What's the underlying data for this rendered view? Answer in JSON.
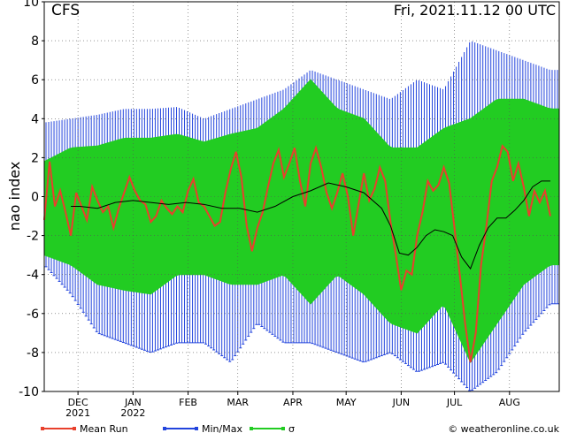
{
  "model_label": "CFS",
  "run_label": "Fri, 2021.11.12   00 UTC",
  "credit": "© weatheronline.co.uk",
  "legend": [
    {
      "label": "Mean Run",
      "color": "#e8402c"
    },
    {
      "label": "Min/Max",
      "color": "#2244dd"
    },
    {
      "label": "σ",
      "color": "#22cc22"
    }
  ],
  "chart_data": {
    "type": "line",
    "title": "",
    "ylabel": "nao index",
    "ylim": [
      -10,
      10
    ],
    "yticks": [
      -10,
      -8,
      -6,
      -4,
      -2,
      0,
      2,
      4,
      6,
      8,
      10
    ],
    "xlim": [
      0,
      290
    ],
    "month_ticks": [
      {
        "label": "DEC",
        "sub": "2021",
        "x": 19
      },
      {
        "label": "JAN",
        "sub": "2022",
        "x": 50
      },
      {
        "label": "FEB",
        "sub": "",
        "x": 81
      },
      {
        "label": "MAR",
        "sub": "",
        "x": 109
      },
      {
        "label": "APR",
        "sub": "",
        "x": 140
      },
      {
        "label": "MAY",
        "sub": "",
        "x": 170
      },
      {
        "label": "JUN",
        "sub": "",
        "x": 201
      },
      {
        "label": "JUL",
        "sub": "",
        "x": 231
      },
      {
        "label": "AUG",
        "sub": "",
        "x": 262
      }
    ],
    "series": [
      {
        "name": "Mean Run",
        "color": "#e8402c",
        "points": [
          [
            0,
            -1.2
          ],
          [
            3,
            1.8
          ],
          [
            6,
            -0.5
          ],
          [
            9,
            0.3
          ],
          [
            12,
            -0.8
          ],
          [
            15,
            -2.0
          ],
          [
            18,
            0.2
          ],
          [
            21,
            -0.5
          ],
          [
            24,
            -1.2
          ],
          [
            27,
            0.5
          ],
          [
            30,
            -0.2
          ],
          [
            33,
            -0.8
          ],
          [
            36,
            -0.5
          ],
          [
            39,
            -1.6
          ],
          [
            42,
            -0.6
          ],
          [
            45,
            0.2
          ],
          [
            48,
            1.0
          ],
          [
            51,
            0.3
          ],
          [
            54,
            -0.2
          ],
          [
            57,
            -0.4
          ],
          [
            60,
            -1.3
          ],
          [
            63,
            -1.0
          ],
          [
            66,
            -0.2
          ],
          [
            69,
            -0.6
          ],
          [
            72,
            -0.9
          ],
          [
            75,
            -0.5
          ],
          [
            78,
            -0.8
          ],
          [
            81,
            0.3
          ],
          [
            84,
            0.9
          ],
          [
            87,
            -0.3
          ],
          [
            90,
            -0.5
          ],
          [
            93,
            -1.0
          ],
          [
            96,
            -1.5
          ],
          [
            99,
            -1.3
          ],
          [
            102,
            0.2
          ],
          [
            105,
            1.4
          ],
          [
            108,
            2.3
          ],
          [
            111,
            1.0
          ],
          [
            114,
            -1.5
          ],
          [
            117,
            -2.8
          ],
          [
            120,
            -1.6
          ],
          [
            123,
            -0.8
          ],
          [
            126,
            0.5
          ],
          [
            129,
            1.7
          ],
          [
            132,
            2.4
          ],
          [
            135,
            1.0
          ],
          [
            138,
            1.7
          ],
          [
            141,
            2.5
          ],
          [
            144,
            0.8
          ],
          [
            147,
            -0.5
          ],
          [
            150,
            1.7
          ],
          [
            153,
            2.5
          ],
          [
            156,
            1.5
          ],
          [
            159,
            0.2
          ],
          [
            162,
            -0.6
          ],
          [
            165,
            0.2
          ],
          [
            168,
            1.2
          ],
          [
            171,
            0.0
          ],
          [
            174,
            -2.0
          ],
          [
            177,
            -0.4
          ],
          [
            180,
            1.2
          ],
          [
            183,
            -0.2
          ],
          [
            186,
            0.4
          ],
          [
            189,
            1.5
          ],
          [
            192,
            0.8
          ],
          [
            195,
            -1.3
          ],
          [
            198,
            -3.0
          ],
          [
            201,
            -4.8
          ],
          [
            204,
            -3.8
          ],
          [
            207,
            -4.0
          ],
          [
            210,
            -2.0
          ],
          [
            213,
            -0.8
          ],
          [
            216,
            0.8
          ],
          [
            219,
            0.3
          ],
          [
            222,
            0.6
          ],
          [
            225,
            1.5
          ],
          [
            228,
            0.7
          ],
          [
            231,
            -1.6
          ],
          [
            234,
            -4.0
          ],
          [
            237,
            -6.5
          ],
          [
            240,
            -8.5
          ],
          [
            243,
            -7.0
          ],
          [
            246,
            -3.5
          ],
          [
            249,
            -1.5
          ],
          [
            252,
            0.8
          ],
          [
            255,
            1.5
          ],
          [
            258,
            2.6
          ],
          [
            261,
            2.3
          ],
          [
            264,
            0.8
          ],
          [
            267,
            1.7
          ],
          [
            270,
            0.5
          ],
          [
            273,
            -1.0
          ],
          [
            276,
            0.3
          ],
          [
            279,
            -0.3
          ],
          [
            282,
            0.3
          ],
          [
            285,
            -1.0
          ]
        ]
      },
      {
        "name": "",
        "color": "#000000",
        "points": [
          [
            15,
            -0.5
          ],
          [
            20,
            -0.5
          ],
          [
            30,
            -0.6
          ],
          [
            40,
            -0.3
          ],
          [
            50,
            -0.2
          ],
          [
            60,
            -0.3
          ],
          [
            70,
            -0.4
          ],
          [
            80,
            -0.3
          ],
          [
            90,
            -0.4
          ],
          [
            100,
            -0.6
          ],
          [
            110,
            -0.6
          ],
          [
            120,
            -0.8
          ],
          [
            130,
            -0.5
          ],
          [
            140,
            0.0
          ],
          [
            150,
            0.3
          ],
          [
            160,
            0.7
          ],
          [
            170,
            0.5
          ],
          [
            180,
            0.2
          ],
          [
            190,
            -0.6
          ],
          [
            195,
            -1.5
          ],
          [
            200,
            -2.9
          ],
          [
            205,
            -3.0
          ],
          [
            210,
            -2.6
          ],
          [
            215,
            -2.0
          ],
          [
            220,
            -1.7
          ],
          [
            225,
            -1.8
          ],
          [
            230,
            -2.0
          ],
          [
            235,
            -3.1
          ],
          [
            240,
            -3.7
          ],
          [
            245,
            -2.5
          ],
          [
            250,
            -1.6
          ],
          [
            255,
            -1.1
          ],
          [
            260,
            -1.1
          ],
          [
            265,
            -0.7
          ],
          [
            270,
            -0.2
          ],
          [
            275,
            0.5
          ],
          [
            280,
            0.8
          ],
          [
            285,
            0.8
          ]
        ]
      }
    ],
    "minmax_envelope": {
      "name": "Min/Max",
      "color": "#2244dd",
      "points": [
        [
          0,
          -3.5,
          3.8
        ],
        [
          15,
          -5.0,
          4.0
        ],
        [
          30,
          -7.0,
          4.2
        ],
        [
          45,
          -7.5,
          4.5
        ],
        [
          60,
          -8.0,
          4.5
        ],
        [
          75,
          -7.5,
          4.6
        ],
        [
          90,
          -7.5,
          4.0
        ],
        [
          105,
          -8.5,
          4.5
        ],
        [
          120,
          -6.5,
          5.0
        ],
        [
          135,
          -7.5,
          5.5
        ],
        [
          150,
          -7.5,
          6.5
        ],
        [
          165,
          -8.0,
          6.0
        ],
        [
          180,
          -8.5,
          5.5
        ],
        [
          195,
          -8.0,
          5.0
        ],
        [
          210,
          -9.0,
          6.0
        ],
        [
          225,
          -8.5,
          5.5
        ],
        [
          240,
          -10.0,
          8.0
        ],
        [
          255,
          -9.0,
          7.5
        ],
        [
          270,
          -7.0,
          7.0
        ],
        [
          285,
          -5.5,
          6.5
        ]
      ]
    },
    "sigma_envelope": {
      "name": "σ",
      "color": "#22cc22",
      "points": [
        [
          0,
          -3.0,
          1.8
        ],
        [
          15,
          -3.5,
          2.5
        ],
        [
          30,
          -4.5,
          2.6
        ],
        [
          45,
          -4.8,
          3.0
        ],
        [
          60,
          -5.0,
          3.0
        ],
        [
          75,
          -4.0,
          3.2
        ],
        [
          90,
          -4.0,
          2.8
        ],
        [
          105,
          -4.5,
          3.2
        ],
        [
          120,
          -4.5,
          3.5
        ],
        [
          135,
          -4.0,
          4.5
        ],
        [
          150,
          -5.5,
          6.0
        ],
        [
          165,
          -4.0,
          4.5
        ],
        [
          180,
          -5.0,
          4.0
        ],
        [
          195,
          -6.5,
          2.5
        ],
        [
          210,
          -7.0,
          2.5
        ],
        [
          225,
          -5.5,
          3.5
        ],
        [
          240,
          -8.5,
          4.0
        ],
        [
          255,
          -6.5,
          5.0
        ],
        [
          270,
          -4.5,
          5.0
        ],
        [
          285,
          -3.5,
          4.5
        ]
      ]
    }
  }
}
